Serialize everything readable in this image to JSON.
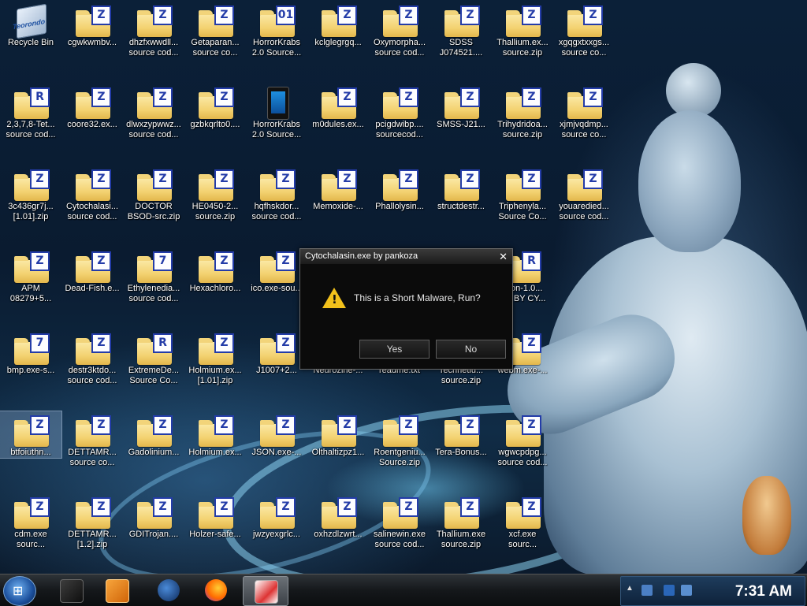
{
  "desktop": {
    "icons": [
      {
        "label": "Recycle Bin",
        "type": "bin"
      },
      {
        "label": "cgwkwmbv...",
        "type": "folder",
        "badge": "Z"
      },
      {
        "label": "dhzfxwwdll...\nsource cod...",
        "type": "folder",
        "badge": "Z"
      },
      {
        "label": "Getaparan...\nsource co...",
        "type": "folder",
        "badge": "Z"
      },
      {
        "label": "HorrorKrabs\n2.0 Source...",
        "type": "folder",
        "badge": "01"
      },
      {
        "label": "kclglegrgq...",
        "type": "folder",
        "badge": "Z"
      },
      {
        "label": "Oxymorpha...\nsource cod...",
        "type": "folder",
        "badge": "Z"
      },
      {
        "label": "SDSS\nJ074521....",
        "type": "folder",
        "badge": "Z"
      },
      {
        "label": "Thallium.ex...\nsource.zip",
        "type": "folder",
        "badge": "Z"
      },
      {
        "label": "xgqgxtxxgs...\nsource co...",
        "type": "folder",
        "badge": "Z"
      },
      {
        "label": "2,3,7,8-Tet...\nsource cod...",
        "type": "folder",
        "badge": "R"
      },
      {
        "label": "coore32.ex...",
        "type": "folder",
        "badge": "Z"
      },
      {
        "label": "dlwxzypwwz...\nsource cod...",
        "type": "folder",
        "badge": "Z"
      },
      {
        "label": "gzbkqrlto0....",
        "type": "folder",
        "badge": "Z"
      },
      {
        "label": "HorrorKrabs\n2.0 Source...",
        "type": "tablet"
      },
      {
        "label": "m0dules.ex...",
        "type": "folder",
        "badge": "Z"
      },
      {
        "label": "pcigdwibp....\nsourcecod...",
        "type": "folder",
        "badge": "Z"
      },
      {
        "label": "SMSS-J21...",
        "type": "folder",
        "badge": "Z"
      },
      {
        "label": "Trihydridoa...\nsource.zip",
        "type": "folder",
        "badge": "Z"
      },
      {
        "label": "xjmjvqdmp...\nsource co...",
        "type": "folder",
        "badge": "Z"
      },
      {
        "label": "3c436gr7j...\n[1.01].zip",
        "type": "folder",
        "badge": "Z"
      },
      {
        "label": "Cytochalasi...\nsource cod...",
        "type": "folder",
        "badge": "Z"
      },
      {
        "label": "DOCTOR\nBSOD-src.zip",
        "type": "folder",
        "badge": "Z"
      },
      {
        "label": "HE0450-2...\nsource.zip",
        "type": "folder",
        "badge": "Z"
      },
      {
        "label": "hqfhskdor...\nsource cod...",
        "type": "folder",
        "badge": "Z"
      },
      {
        "label": "Memoxide-...",
        "type": "folder",
        "badge": "Z"
      },
      {
        "label": "Phallolysin...",
        "type": "folder",
        "badge": "Z"
      },
      {
        "label": "structdestr...",
        "type": "folder",
        "badge": "Z"
      },
      {
        "label": "Triphenyla...\nSource Co...",
        "type": "folder",
        "badge": "Z"
      },
      {
        "label": "youaredied...\nsource cod...",
        "type": "folder",
        "badge": "Z"
      },
      {
        "label": "APM\n08279+5...",
        "type": "folder",
        "badge": "Z"
      },
      {
        "label": "Dead-Fish.e...",
        "type": "folder",
        "badge": "Z"
      },
      {
        "label": "Ethylenedia...\nsource cod...",
        "type": "folder",
        "badge": "7"
      },
      {
        "label": "Hexachloro...",
        "type": "folder",
        "badge": "Z"
      },
      {
        "label": "ico.exe-sou...",
        "type": "folder",
        "badge": "Z"
      },
      {
        "label": "ision-1.0...\nCE BY CY...",
        "type": "folder",
        "badge": "R"
      },
      {
        "label": "bmp.exe-s...",
        "type": "folder",
        "badge": "7"
      },
      {
        "label": "destr3ktdo...\nsource cod...",
        "type": "folder",
        "badge": "Z"
      },
      {
        "label": "ExtremeDe...\nSource Co...",
        "type": "folder",
        "badge": "R"
      },
      {
        "label": "Holmium.ex...\n[1.01].zip",
        "type": "folder",
        "badge": "Z"
      },
      {
        "label": "J1007+2...",
        "type": "folder",
        "badge": "Z"
      },
      {
        "label": "Neurozine-...",
        "type": "folder",
        "badge": "Z"
      },
      {
        "label": "readme.txt",
        "type": "folder",
        "badge": "Z"
      },
      {
        "label": "Technetiu...\nsource.zip",
        "type": "folder",
        "badge": "Z"
      },
      {
        "label": "webm.exe-...",
        "type": "folder",
        "badge": "Z"
      },
      {
        "label": "btfoiuthn...",
        "type": "folder",
        "badge": "Z"
      },
      {
        "label": "DETTAMR...\nsource co...",
        "type": "folder",
        "badge": "Z"
      },
      {
        "label": "Gadolinium...",
        "type": "folder",
        "badge": "Z"
      },
      {
        "label": "Holmium.ex...",
        "type": "folder",
        "badge": "Z"
      },
      {
        "label": "JSON.exe-...",
        "type": "folder",
        "badge": "Z"
      },
      {
        "label": "Olthaltizpz1...",
        "type": "folder",
        "badge": "Z"
      },
      {
        "label": "Roentgeniu...\nSource.zip",
        "type": "folder",
        "badge": "Z"
      },
      {
        "label": "Tera-Bonus...",
        "type": "folder",
        "badge": "Z"
      },
      {
        "label": "wgwcpdpg...\nsource cod...",
        "type": "folder",
        "badge": "Z"
      },
      {
        "label": "cdm.exe\nsourc...",
        "type": "folder",
        "badge": "Z"
      },
      {
        "label": "DETTAMR...\n[1.2].zip",
        "type": "folder",
        "badge": "Z"
      },
      {
        "label": "GDITrojan....",
        "type": "folder",
        "badge": "Z"
      },
      {
        "label": "Holzer-safe...",
        "type": "folder",
        "badge": "Z"
      },
      {
        "label": "jwzyexgrlc...",
        "type": "folder",
        "badge": "Z"
      },
      {
        "label": "oxhzdlzwrt...",
        "type": "folder",
        "badge": "Z"
      },
      {
        "label": "salinewin.exe\nsource cod...",
        "type": "folder",
        "badge": "Z"
      },
      {
        "label": "Thallium.exe\nsource.zip",
        "type": "folder",
        "badge": "Z"
      },
      {
        "label": "xcf.exe\nsourc...",
        "type": "folder",
        "badge": "Z"
      }
    ]
  },
  "dialog": {
    "title": "Cytochalasin.exe by pankoza",
    "close": "✕",
    "message": "This is a Short Malware, Run?",
    "yes_label": "Yes",
    "no_label": "No"
  },
  "taskbar": {
    "start_icon": "windows-orb-icon",
    "pinned": [
      "terminal-icon",
      "media-player-icon",
      "globe-icon",
      "firefox-icon",
      "file-manager-icon"
    ],
    "clock": "7:31 AM"
  }
}
